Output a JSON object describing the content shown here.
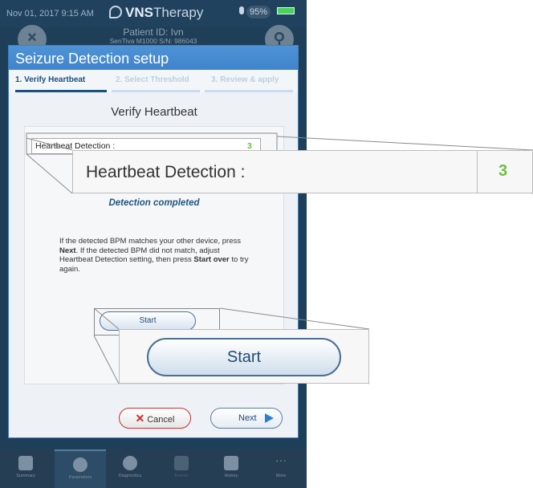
{
  "status_bar": {
    "datetime": "Nov 01, 2017  9:15 AM",
    "brand_bold": "VNS",
    "brand_rest": "Therapy",
    "battery": "95%"
  },
  "patient": {
    "id_label": "Patient ID: Ivn",
    "device": "SenTiva M1000 S/N: 986043"
  },
  "modal": {
    "title": "Seizure Detection setup",
    "steps": [
      {
        "label": "1. Verify Heartbeat",
        "active": true
      },
      {
        "label": "2. Select Threshold",
        "active": false
      },
      {
        "label": "3. Review & apply",
        "active": false
      }
    ],
    "heading": "Verify Heartbeat",
    "heartbeat_label": "Heartbeat Detection :",
    "heartbeat_value": "3",
    "status": "Detection completed",
    "instructions": {
      "p1": "If the detected BPM matches your other device, press ",
      "next_word": "Next",
      "p2": ". If the detected BPM did not match, adjust Heartbeat Detection setting, then press ",
      "start_over": "Start over",
      "p3": " to try again."
    },
    "start_label": "Start",
    "cancel_label": "Cancel",
    "next_label": "Next"
  },
  "tabs": [
    {
      "label": "Summary",
      "icon": "summary-icon"
    },
    {
      "label": "Parameters",
      "icon": "parameters-icon",
      "active": true
    },
    {
      "label": "Diagnostics",
      "icon": "diagnostics-icon"
    },
    {
      "label": "Events",
      "icon": "events-icon",
      "disabled": true
    },
    {
      "label": "History",
      "icon": "history-icon"
    },
    {
      "label": "More",
      "icon": "more-icon"
    }
  ],
  "zoom": {
    "heartbeat_label": "Heartbeat Detection :",
    "heartbeat_value": "3",
    "start_label": "Start"
  },
  "colors": {
    "header_bg": "#20425e",
    "modal_title": "#4f93d6",
    "active_step": "#1d4f7c",
    "value_green": "#6cbf3f",
    "cancel_red": "#d42a2a"
  }
}
